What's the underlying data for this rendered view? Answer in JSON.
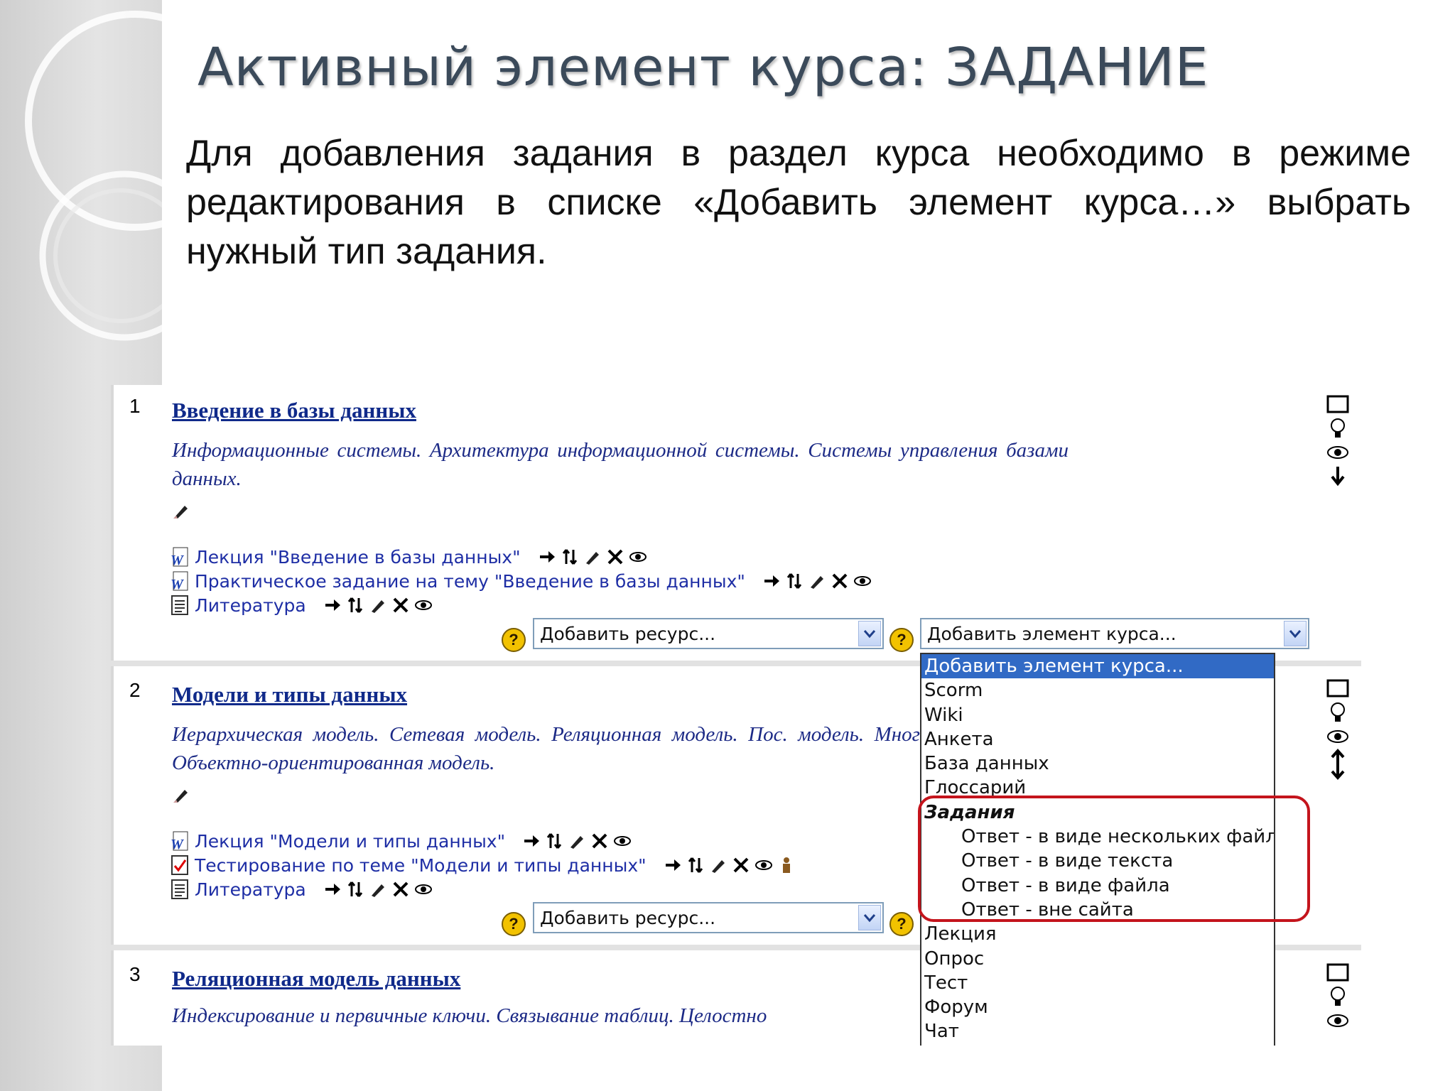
{
  "slide": {
    "title": "Активный элемент курса: ЗАДАНИЕ",
    "body": "Для добавления задания в раздел курса необходимо в режиме редактирования в списке «Добавить элемент курса…» выбрать нужный тип задания."
  },
  "sections": [
    {
      "number": "1",
      "title": "Введение в базы данных",
      "summary": "Информационные системы. Архитектура информационной системы. Системы управления базами данных.",
      "resources": [
        {
          "icon": "word-doc-icon",
          "label": "Лекция \"Введение в базы данных\""
        },
        {
          "icon": "word-doc-icon",
          "label": "Практическое задание на тему \"Введение в базы данных\""
        },
        {
          "icon": "text-page-icon",
          "label": "Литература"
        }
      ],
      "add_resource": "Добавить ресурс...",
      "add_activity": "Добавить элемент курса..."
    },
    {
      "number": "2",
      "title": "Модели и типы данных",
      "summary": "Иерархическая модель. Сетевая модель. Реляционная модель. Пос. модель. Многомерная модель. Объектно-ориентированная модель.",
      "resources": [
        {
          "icon": "word-doc-icon",
          "label": "Лекция \"Модели и типы данных\""
        },
        {
          "icon": "quiz-icon",
          "label": "Тестирование по теме \"Модели и типы данных\""
        },
        {
          "icon": "text-page-icon",
          "label": "Литература"
        }
      ],
      "add_resource": "Добавить ресурс..."
    },
    {
      "number": "3",
      "title": "Реляционная модель данных",
      "summary": "Индексирование и первичные ключи. Связывание таблиц. Целостно"
    }
  ],
  "dropdown": {
    "items": [
      {
        "label": "Добавить элемент курса...",
        "kind": "selected"
      },
      {
        "label": "Scorm",
        "kind": "item"
      },
      {
        "label": "Wiki",
        "kind": "item"
      },
      {
        "label": "Анкета",
        "kind": "item"
      },
      {
        "label": "База данных",
        "kind": "item"
      },
      {
        "label": "Глоссарий",
        "kind": "item"
      },
      {
        "label": "Задания",
        "kind": "group"
      },
      {
        "label": "Ответ - в виде нескольких файлов",
        "kind": "sub"
      },
      {
        "label": "Ответ - в виде текста",
        "kind": "sub"
      },
      {
        "label": "Ответ - в виде файла",
        "kind": "sub"
      },
      {
        "label": "Ответ - вне сайта",
        "kind": "sub"
      },
      {
        "label": "Лекция",
        "kind": "item"
      },
      {
        "label": "Опрос",
        "kind": "item"
      },
      {
        "label": "Тест",
        "kind": "item"
      },
      {
        "label": "Форум",
        "kind": "item"
      },
      {
        "label": "Чат",
        "kind": "item"
      }
    ]
  },
  "colors": {
    "link": "#1e2ea5",
    "section_title": "#102a8a",
    "selection": "#316ac5",
    "highlight": "#c4141c"
  }
}
